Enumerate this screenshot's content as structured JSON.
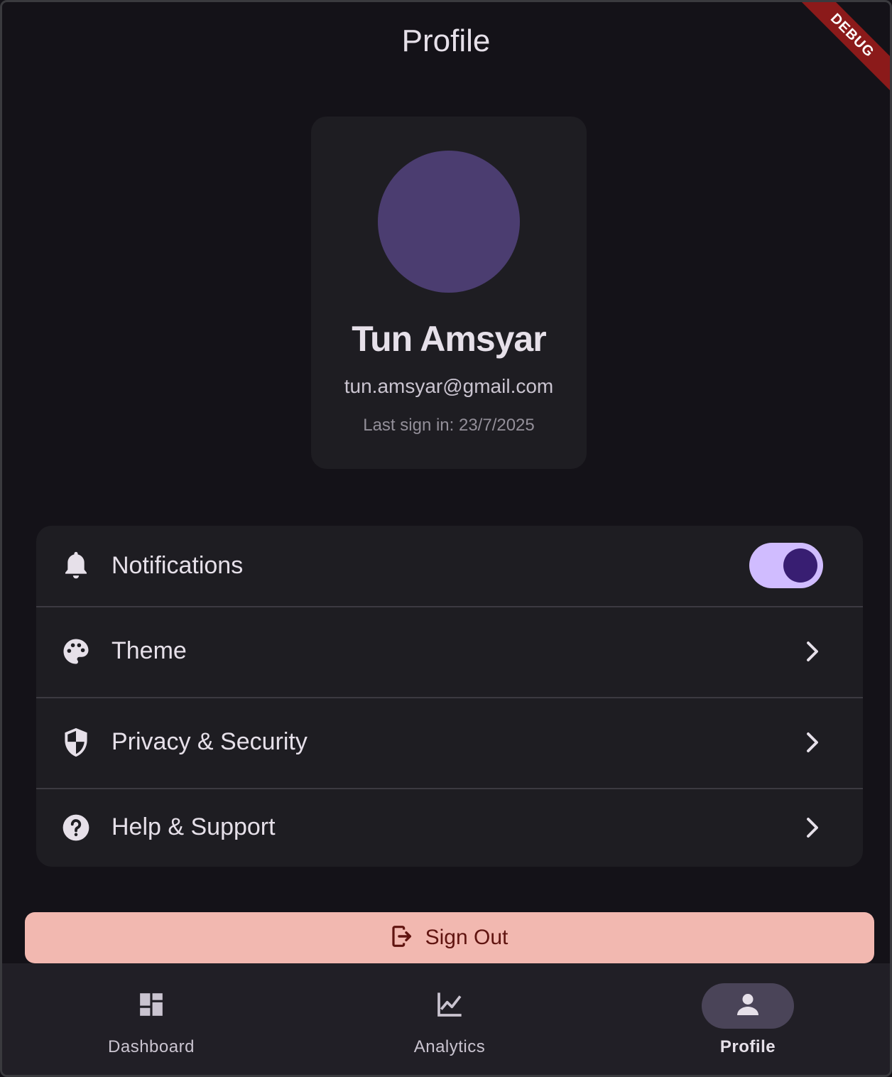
{
  "header": {
    "title": "Profile",
    "debug_label": "DEBUG"
  },
  "profile": {
    "name": "Tun Amsyar",
    "email": "tun.amsyar@gmail.com",
    "last_sign_in": "Last sign in: 23/7/2025",
    "avatar_color": "#4b3d70"
  },
  "settings": [
    {
      "label": "Notifications",
      "icon": "bell-icon",
      "control": "toggle",
      "enabled": true
    },
    {
      "label": "Theme",
      "icon": "palette-icon",
      "control": "chevron"
    },
    {
      "label": "Privacy & Security",
      "icon": "shield-icon",
      "control": "chevron"
    },
    {
      "label": "Help & Support",
      "icon": "help-icon",
      "control": "chevron"
    }
  ],
  "signout": {
    "label": "Sign Out",
    "icon": "logout-icon",
    "background": "#f2b8b0",
    "text_color": "#601410"
  },
  "nav": {
    "items": [
      {
        "label": "Dashboard",
        "icon": "dashboard-icon",
        "active": false
      },
      {
        "label": "Analytics",
        "icon": "analytics-icon",
        "active": false
      },
      {
        "label": "Profile",
        "icon": "person-icon",
        "active": true
      }
    ]
  },
  "colors": {
    "background": "#141218",
    "card": "#1e1d22",
    "accent": "#d0bcff",
    "text": "#e6e0e9"
  }
}
